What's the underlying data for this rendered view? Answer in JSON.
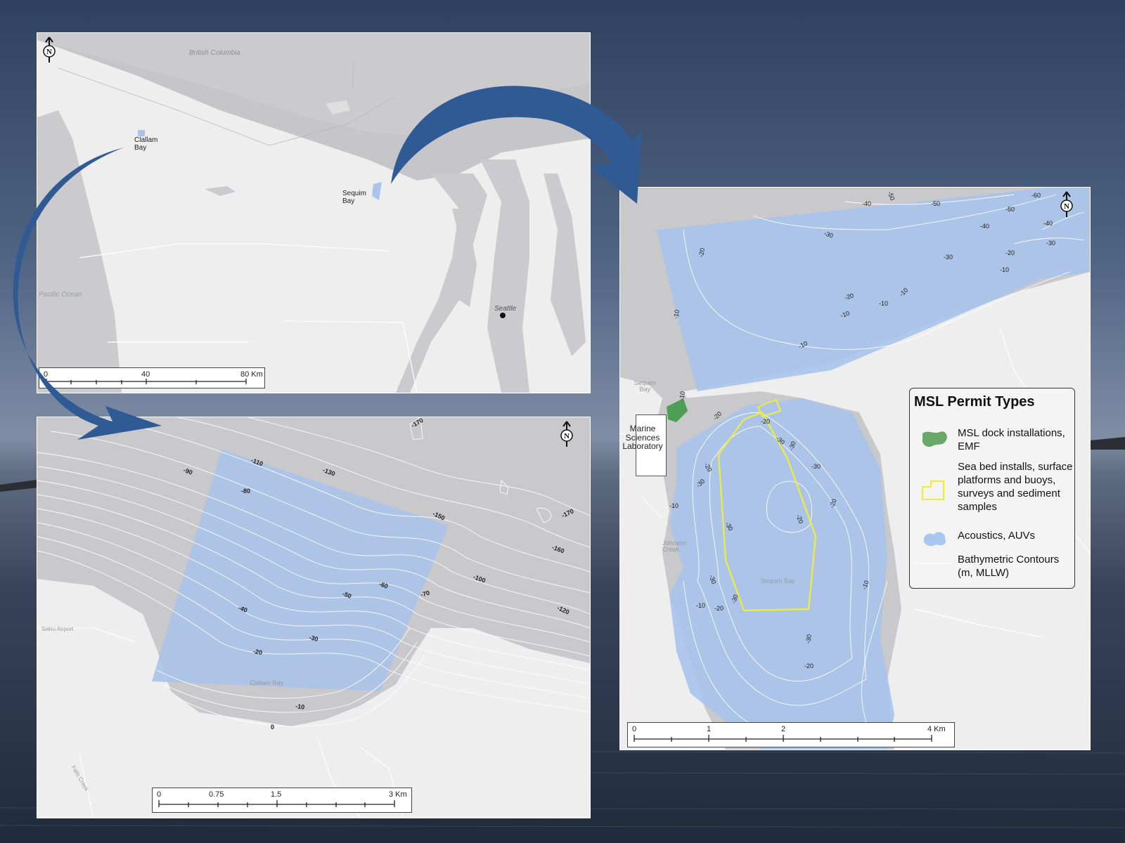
{
  "overview_map": {
    "labels": {
      "british_columbia": "British Columbia",
      "clallam_bay": "Clallam\nBay",
      "sequim_bay": "Sequim\nBay",
      "pacific_ocean": "Pacific Ocean",
      "seattle": "Seattle"
    },
    "scale_bar": [
      "0",
      "40",
      "80 Km"
    ],
    "north_arrow": "N"
  },
  "clallam_map": {
    "labels": {
      "clallam_bay": "Clallam Bay",
      "sekiu_airport": "Sekiu Airport",
      "falls_creek": "Falls Creek"
    },
    "contours": [
      "-170",
      "-90",
      "-110",
      "-130",
      "-80",
      "-150",
      "-170",
      "-160",
      "-100",
      "-60",
      "-70",
      "-50",
      "-40",
      "-120",
      "-30",
      "-20",
      "-10",
      "0"
    ],
    "scale_bar": [
      "0",
      "0.75",
      "1.5",
      "3 Km"
    ],
    "north_arrow": "N"
  },
  "sequim_map": {
    "labels": {
      "sequim_bay_town": "Sequim\nBay",
      "marine_sciences_laboratory": "Marine\nSciences\nLaboratory",
      "johnson_creek": "Johnson\nCreek",
      "sequim_bay_water": "Sequim Bay"
    },
    "contours": [
      "-50",
      "-40",
      "-50",
      "-60",
      "-50",
      "-40",
      "-40",
      "-30",
      "-30",
      "-20",
      "-30",
      "-10",
      "-20",
      "-20",
      "-10",
      "-10",
      "-10",
      "-10",
      "-10",
      "-10",
      "-20",
      "-20",
      "-30",
      "-30",
      "-30",
      "-20",
      "-10",
      "-30",
      "-20",
      "-30",
      "-20",
      "-30",
      "-30",
      "-10",
      "-10",
      "-20",
      "-30",
      "-20"
    ],
    "scale_bar": [
      "0",
      "1",
      "2",
      "4 Km"
    ],
    "north_arrow": "N"
  },
  "legend": {
    "title": "MSL Permit Types",
    "items": [
      {
        "label": "MSL dock installations, EMF",
        "swatch": "green-blob",
        "color": "#6aa86a"
      },
      {
        "label": "Sea bed installs, surface platforms and buoys, surveys and sediment samples",
        "swatch": "yellow-outline",
        "color": "#f0f03a"
      },
      {
        "label": "Acoustics, AUVs",
        "swatch": "blue-blob",
        "color": "#a9c6ef"
      },
      {
        "label": "Bathymetric Contours (m, MLLW)",
        "swatch": "white-line",
        "color": "#ffffff"
      }
    ]
  },
  "colors": {
    "water": "#c9c9cc",
    "land": "#ededed",
    "acoustic_area": "#a9c3ea",
    "arrow": "#2f5a94",
    "permit_outline": "#eded3c",
    "dock": "#4f9e55"
  }
}
